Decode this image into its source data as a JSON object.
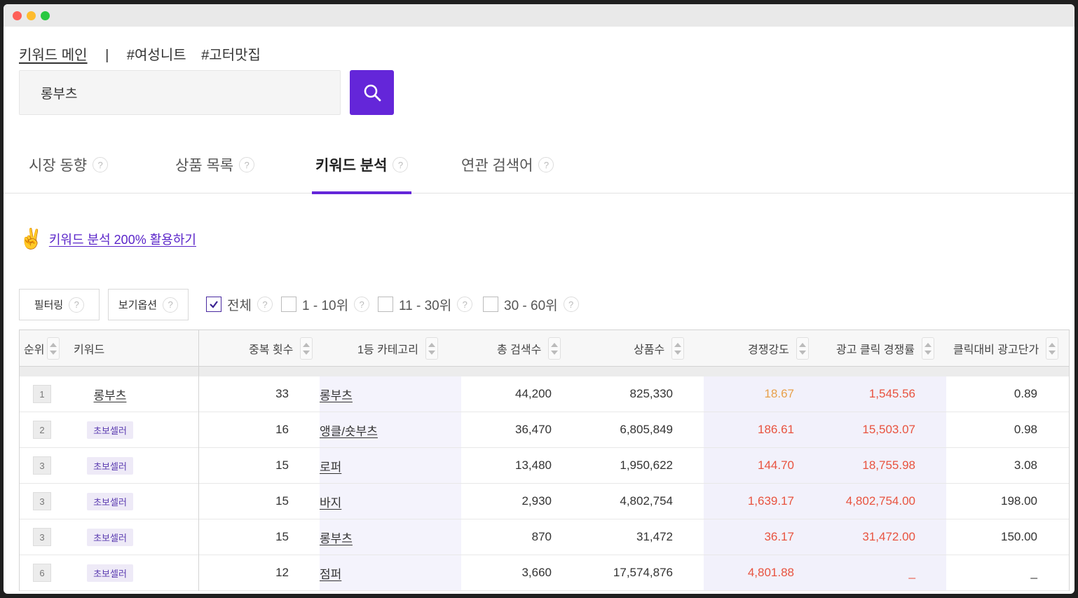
{
  "topnav": {
    "main": "키워드 메인",
    "separator": "|",
    "tags": [
      "#여성니트",
      "#고터맛집"
    ]
  },
  "search": {
    "value": "롱부츠"
  },
  "tabs": [
    {
      "label": "시장 동향",
      "help": "?"
    },
    {
      "label": "상품 목록",
      "help": "?"
    },
    {
      "label": "키워드 분석",
      "help": "?"
    },
    {
      "label": "연관 검색어",
      "help": "?"
    }
  ],
  "guide": {
    "label": "키워드 분석 200% 활용하기"
  },
  "controls": {
    "filter": "필터링",
    "view_options": "보기옵션",
    "help": "?",
    "checks": [
      {
        "label": "전체",
        "checked": true
      },
      {
        "label": "1 - 10위",
        "checked": false
      },
      {
        "label": "11 - 30위",
        "checked": false
      },
      {
        "label": "30 - 60위",
        "checked": false
      }
    ]
  },
  "table": {
    "headers": [
      "순위",
      "키워드",
      "중복 횟수",
      "1등 카테고리",
      "총 검색수",
      "상품수",
      "경쟁강도",
      "광고 클릭 경쟁률",
      "클릭대비 광고단가"
    ],
    "rows": [
      {
        "rank": "1",
        "keyword": "롱부츠",
        "badge": "",
        "dup": "33",
        "category": "롱부츠",
        "searches": "44,200",
        "products": "825,330",
        "competition": "18.67",
        "ad_click": "1,545.56",
        "ad_price": "0.89"
      },
      {
        "rank": "2",
        "keyword": "",
        "badge": "초보셀러",
        "dup": "16",
        "category": "앵클/숏부츠",
        "searches": "36,470",
        "products": "6,805,849",
        "competition": "186.61",
        "ad_click": "15,503.07",
        "ad_price": "0.98"
      },
      {
        "rank": "3",
        "keyword": "",
        "badge": "초보셀러",
        "dup": "15",
        "category": "로퍼",
        "searches": "13,480",
        "products": "1,950,622",
        "competition": "144.70",
        "ad_click": "18,755.98",
        "ad_price": "3.08"
      },
      {
        "rank": "3",
        "keyword": "",
        "badge": "초보셀러",
        "dup": "15",
        "category": "바지",
        "searches": "2,930",
        "products": "4,802,754",
        "competition": "1,639.17",
        "ad_click": "4,802,754.00",
        "ad_price": "198.00"
      },
      {
        "rank": "3",
        "keyword": "",
        "badge": "초보셀러",
        "dup": "15",
        "category": "롱부츠",
        "searches": "870",
        "products": "31,472",
        "competition": "36.17",
        "ad_click": "31,472.00",
        "ad_price": "150.00"
      },
      {
        "rank": "6",
        "keyword": "",
        "badge": "초보셀러",
        "dup": "12",
        "category": "점퍼",
        "searches": "3,660",
        "products": "17,574,876",
        "competition": "4,801.88",
        "ad_click": "_",
        "ad_price": "_"
      }
    ]
  },
  "colors": {
    "accent": "#6426d9",
    "orange": "#e8a04a",
    "red": "#e8533f"
  },
  "icons": {
    "search": "search-icon",
    "guide": "victory-hand-icon",
    "help": "question-icon",
    "sort": "sort-icon"
  }
}
